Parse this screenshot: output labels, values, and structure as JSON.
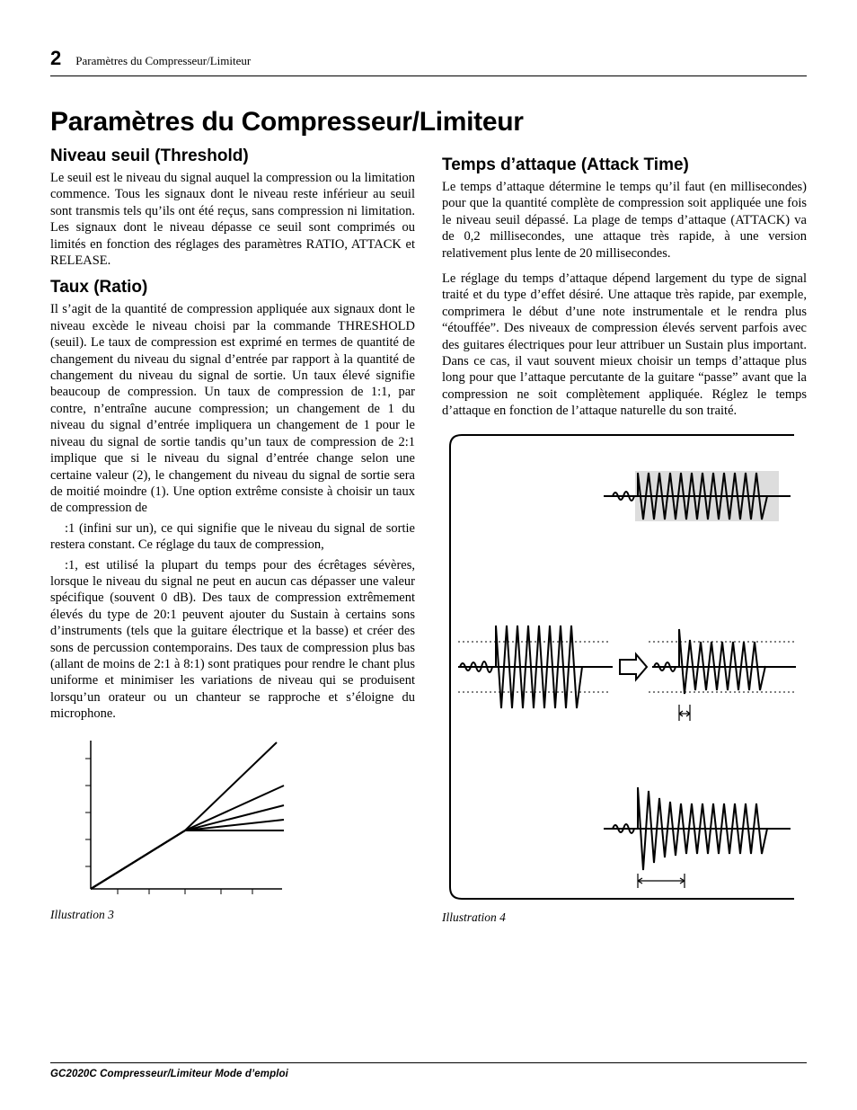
{
  "header": {
    "page_number": "2",
    "running_title": "Paramètres du Compresseur/Limiteur"
  },
  "title": "Paramètres du Compresseur/Limiteur",
  "left": {
    "h_threshold": "Niveau seuil (Threshold)",
    "p_threshold": "Le seuil est le niveau du signal auquel la compression ou la limitation commence. Tous les signaux dont le niveau reste inférieur au seuil sont transmis tels qu’ils ont été reçus, sans compression ni limitation. Les signaux dont le niveau dépasse ce seuil sont comprimés ou limités en fonction des réglages des paramètres RATIO, ATTACK et RELEASE.",
    "h_ratio": "Taux (Ratio)",
    "p_ratio_1": "Il s’agit de la quantité de compression appliquée aux signaux dont le niveau excède le niveau choisi par la commande THRESHOLD (seuil). Le taux de compression est exprimé en termes de quantité de changement du niveau du signal d’entrée par rapport à la quantité de changement du niveau du signal de sortie. Un taux élevé signifie beaucoup de compression. Un taux de compression de 1:1, par contre, n’entraîne aucune compression; un changement de 1 du niveau du signal d’entrée impliquera un changement de 1 pour le niveau du signal de sortie tandis qu’un taux de compression de 2:1 implique que si le niveau du signal d’entrée change selon une certaine valeur (2), le changement du niveau du signal de sortie sera de moitié moindre (1). Une option extrême consiste à choisir un taux de compression de",
    "p_ratio_2": ":1 (infini sur un), ce qui signifie que le niveau du signal de sortie restera constant. Ce réglage du taux de compression,",
    "p_ratio_3": ":1, est utilisé la plupart du temps pour des écrêtages sévères, lorsque le niveau du signal ne peut en aucun cas dépasser une valeur spécifique (souvent 0 dB). Des taux de compression extrêmement élevés du type de 20:1 peuvent ajouter du Sustain à certains sons d’instruments (tels que la guitare électrique et la basse) et créer des sons de percussion contemporains. Des taux de compression plus bas (allant de moins de 2:1 à 8:1) sont pratiques pour rendre le chant plus uniforme et minimiser les variations de niveau qui se produisent lorsqu’un orateur ou un chanteur se rapproche et s’éloigne du microphone.",
    "caption3": "Illustration 3"
  },
  "right": {
    "h_attack": "Temps d’attaque (Attack Time)",
    "p_attack_1": "Le temps d’attaque détermine le temps qu’il faut (en millisecondes) pour que la quantité complète de compression soit appliquée une fois le niveau seuil dépassé. La plage de temps d’attaque (ATTACK) va de 0,2 millisecondes, une attaque très rapide, à une version relativement plus lente de 20 millisecondes.",
    "p_attack_2": "Le réglage du temps d’attaque dépend largement du type de signal traité et du type d’effet désiré. Une attaque très rapide, par exemple, comprimera le début d’une note instrumentale et le rendra plus “étouffée”. Des niveaux de compression élevés servent parfois avec des guitares électriques pour leur attribuer un Sustain plus important. Dans ce cas, il vaut souvent mieux choisir un temps d’attaque plus long pour que l’attaque percutante de la guitare “passe” avant que la compression ne soit complètement appliquée. Réglez le temps d’attaque en fonction de l’attaque naturelle du son traité.",
    "caption4": "Illustration 4"
  },
  "footer": "GC2020C Compresseur/Limiteur Mode d’emploi"
}
